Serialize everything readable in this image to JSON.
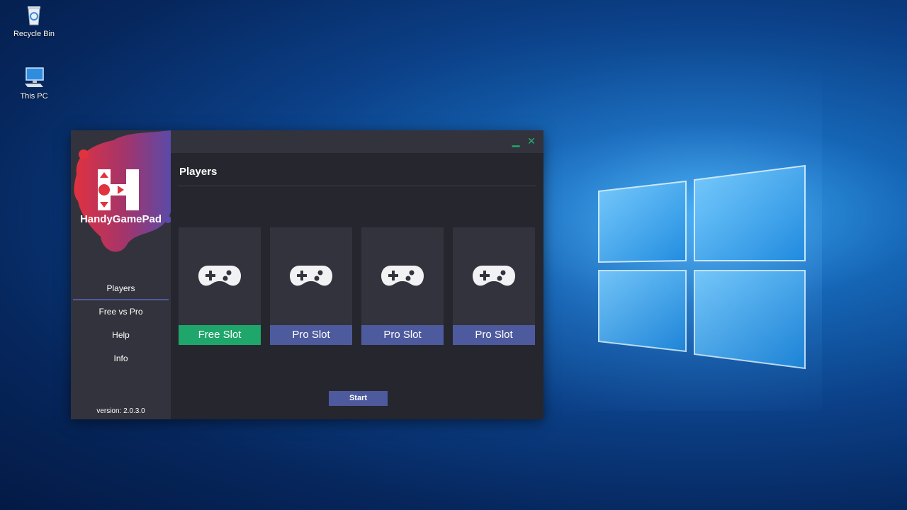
{
  "desktop": {
    "icons": [
      {
        "label": "Recycle Bin",
        "icon": "recycle-bin-icon"
      },
      {
        "label": "This PC",
        "icon": "computer-icon"
      }
    ]
  },
  "app": {
    "brand_name": "HandyGamePad",
    "nav": [
      {
        "label": "Players",
        "active": true
      },
      {
        "label": "Free vs Pro",
        "active": false
      },
      {
        "label": "Help",
        "active": false
      },
      {
        "label": "Info",
        "active": false
      }
    ],
    "version": "version: 2.0.3.0",
    "window_controls": {
      "minimize": "▁",
      "close": "✕"
    },
    "page_title": "Players",
    "slots": [
      {
        "label": "Free Slot",
        "type": "free",
        "icon": "gamepad-icon"
      },
      {
        "label": "Pro Slot",
        "type": "pro",
        "icon": "gamepad-icon"
      },
      {
        "label": "Pro Slot",
        "type": "pro",
        "icon": "gamepad-icon"
      },
      {
        "label": "Pro Slot",
        "type": "pro",
        "icon": "gamepad-icon"
      }
    ],
    "start_label": "Start",
    "colors": {
      "accent_free": "#1fa66a",
      "accent_pro": "#4e5a9e",
      "close_green": "#1fb46e",
      "brand_red": "#e0323f",
      "brand_purple": "#5b4aa8"
    }
  }
}
